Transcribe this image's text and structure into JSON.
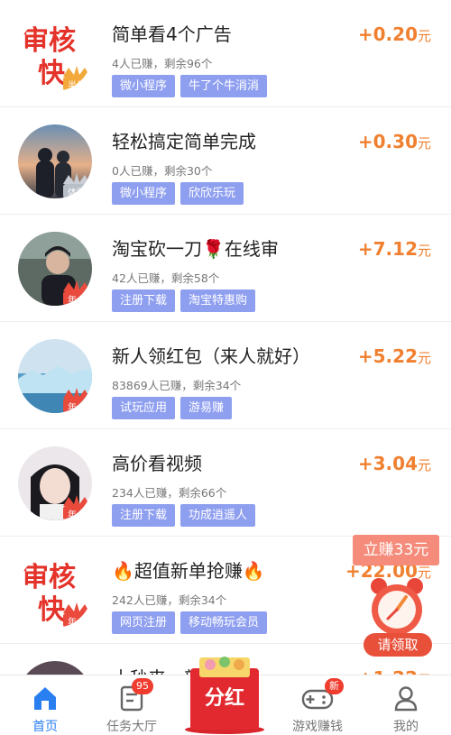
{
  "tasks": [
    {
      "title": "简单看4个广告",
      "meta": "4人已赚，剩余96个",
      "tags": [
        "微小程序",
        "牛了个牛消消"
      ],
      "reward_amount": "+0.20",
      "reward_unit": "元",
      "avatar": "审核快",
      "avatar_badge": "半年"
    },
    {
      "title": "轻松搞定简单完成",
      "meta": "0人已赚，剩余30个",
      "tags": [
        "微小程序",
        "欣欣乐玩"
      ],
      "reward_amount": "+0.30",
      "reward_unit": "元",
      "avatar": "couple-photo",
      "avatar_badge": "体验"
    },
    {
      "title": "淘宝砍一刀🌹在线审",
      "meta": "42人已赚，剩余58个",
      "tags": [
        "注册下载",
        "淘宝特惠购"
      ],
      "reward_amount": "+7.12",
      "reward_unit": "元",
      "avatar": "man-photo",
      "avatar_badge": "年卡"
    },
    {
      "title": "新人领红包（来人就好）",
      "meta": "83869人已赚，剩余34个",
      "tags": [
        "试玩应用",
        "游易赚"
      ],
      "reward_amount": "+5.22",
      "reward_unit": "元",
      "avatar": "glacier-photo",
      "avatar_badge": "年卡"
    },
    {
      "title": "高价看视频",
      "meta": "234人已赚，剩余66个",
      "tags": [
        "注册下载",
        "功成逍遥人"
      ],
      "reward_amount": "+3.04",
      "reward_unit": "元",
      "avatar": "girl-photo",
      "avatar_badge": "年卡"
    },
    {
      "title": "🔥超值新单抢赚🔥",
      "meta": "242人已赚，剩余34个",
      "tags": [
        "网页注册",
        "移动畅玩会员"
      ],
      "reward_amount": "+22.00",
      "reward_unit": "元",
      "avatar": "审核快",
      "avatar_badge": "年卡"
    },
    {
      "title": "十秒来，新手必做",
      "meta": "",
      "tags": [],
      "reward_amount": "+1.22",
      "reward_unit": "元",
      "avatar": "person-photo",
      "avatar_badge": ""
    }
  ],
  "float_widget": {
    "badge": "立赚33元",
    "claim": "请领取"
  },
  "logo_text": {
    "line1": "审核",
    "line2": "快"
  },
  "tabbar": {
    "home": "首页",
    "tasks": "任务大厅",
    "tasks_badge": "95",
    "center": "分红",
    "games": "游戏赚钱",
    "games_badge": "新",
    "mine": "我的"
  },
  "colors": {
    "accent_blue": "#2a7ff0",
    "reward_orange": "#f08030",
    "tag_bg": "#8f9ff0",
    "badge_red": "#f03c2e"
  }
}
